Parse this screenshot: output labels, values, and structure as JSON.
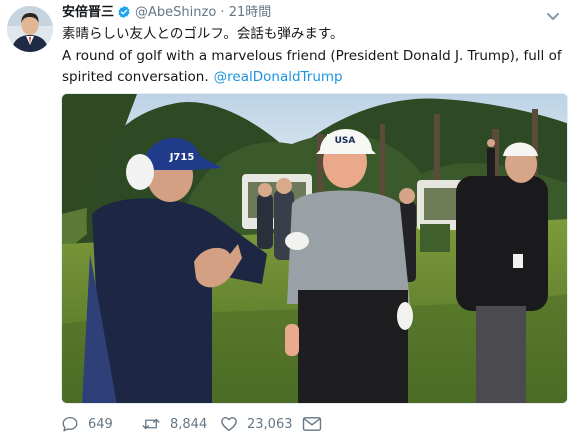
{
  "tweet": {
    "author": {
      "name": "安倍晋三",
      "handle": "@AbeShinzo",
      "verified": true,
      "avatar": "avatar"
    },
    "separator": "·",
    "timestamp": "21時間",
    "text_ja": "素晴らしい友人とのゴルフ。会話も弾みます。",
    "text_en": "A round of golf with a marvelous friend (President Donald J. Trump), full of spirited conversation.",
    "mention": "@realDonaldTrump",
    "media": {
      "type": "photo",
      "cap_texts": [
        "J715",
        "USA"
      ]
    },
    "actions": {
      "reply": {
        "icon": "reply-icon",
        "count": "649"
      },
      "retweet": {
        "icon": "retweet-icon",
        "count": "8,844"
      },
      "like": {
        "icon": "heart-icon",
        "count": "23,063"
      },
      "dm": {
        "icon": "direct-message-icon"
      }
    }
  },
  "colors": {
    "link": "#1b95e0",
    "text": "#14171a",
    "secondary": "#657786",
    "verified": "#1da1f2"
  }
}
